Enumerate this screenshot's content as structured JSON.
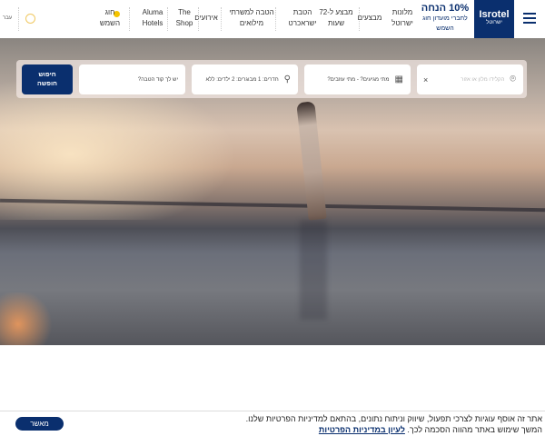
{
  "header": {
    "logo": {
      "text": "Isrotel",
      "subtext": "ישרוטל"
    },
    "promo": {
      "title": "10% הנחה",
      "subtitle": "לחברי מועדון חוג השמש"
    },
    "nav": [
      {
        "label": "מלונות ישרוטל"
      },
      {
        "label": "מבצעים"
      },
      {
        "label": "מבצע ל-72 שעות"
      },
      {
        "label": "הטבת ישראכרט"
      },
      {
        "label": "הטבה למשרתי מילואים"
      },
      {
        "label": "אירועים"
      },
      {
        "label": "The Shop"
      },
      {
        "label": "Aluma Hotels"
      },
      {
        "label": "חוג השמש"
      }
    ],
    "language": "עבר"
  },
  "search": {
    "location_placeholder": "הקלידו מלון או אזור",
    "dates": "מתי מגיעים? - מתי עוזבים?",
    "guests": "חדרים: 1 מבוגרים: 2 ילדים: ללא",
    "code_placeholder": "יש לך קוד הטבה?",
    "button": "חיפוש חופשה"
  },
  "cookie": {
    "line1": "אתר זה אוסף עוגיות לצרכי תפעול, שיווק וניתוח נתונים, בהתאם למדיניות הפרטיות שלנו.",
    "line2": "המשך שימוש באתר מהווה הסכמה לכך.",
    "link": "לעיון במדיניות הפרטיות",
    "button": "מאשר"
  },
  "colors": {
    "brand": "#0a2f6e",
    "accent": "#f5c400"
  }
}
